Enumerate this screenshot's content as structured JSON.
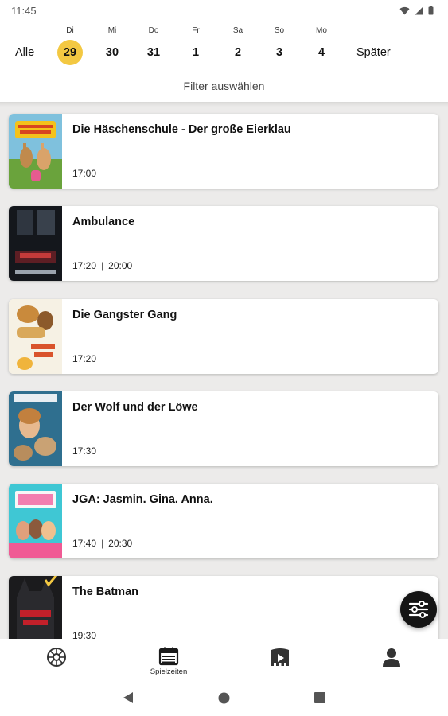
{
  "status_bar": {
    "time": "11:45"
  },
  "date_bar": {
    "all_label": "Alle",
    "later_label": "Später",
    "days": [
      {
        "weekday": "Di",
        "day": "29",
        "selected": true
      },
      {
        "weekday": "Mi",
        "day": "30"
      },
      {
        "weekday": "Do",
        "day": "31"
      },
      {
        "weekday": "Fr",
        "day": "1"
      },
      {
        "weekday": "Sa",
        "day": "2"
      },
      {
        "weekday": "So",
        "day": "3"
      },
      {
        "weekday": "Mo",
        "day": "4"
      }
    ],
    "selected_color": "#f3c842"
  },
  "filter": {
    "label": "Filter auswählen"
  },
  "movies": [
    {
      "title": "Die Häschenschule - Der große Eierklau",
      "times": [
        "17:00"
      ]
    },
    {
      "title": "Ambulance",
      "times": [
        "17:20",
        "20:00"
      ]
    },
    {
      "title": "Die Gangster Gang",
      "times": [
        "17:20"
      ]
    },
    {
      "title": "Der Wolf und der Löwe",
      "times": [
        "17:30"
      ]
    },
    {
      "title": "JGA: Jasmin. Gina. Anna.",
      "times": [
        "17:40",
        "20:30"
      ]
    },
    {
      "title": "The Batman",
      "times": [
        "19:30"
      ]
    }
  ],
  "fab": {
    "icon": "filter-sliders-icon"
  },
  "bottom_nav": {
    "items": [
      {
        "icon": "cinema-reel-icon",
        "label": ""
      },
      {
        "icon": "calendar-icon",
        "label": "Spielzeiten",
        "active": true
      },
      {
        "icon": "movie-screen-icon",
        "label": ""
      },
      {
        "icon": "profile-icon",
        "label": ""
      }
    ]
  },
  "system_nav": {
    "icons": [
      "back-icon",
      "home-icon",
      "recents-icon"
    ]
  }
}
